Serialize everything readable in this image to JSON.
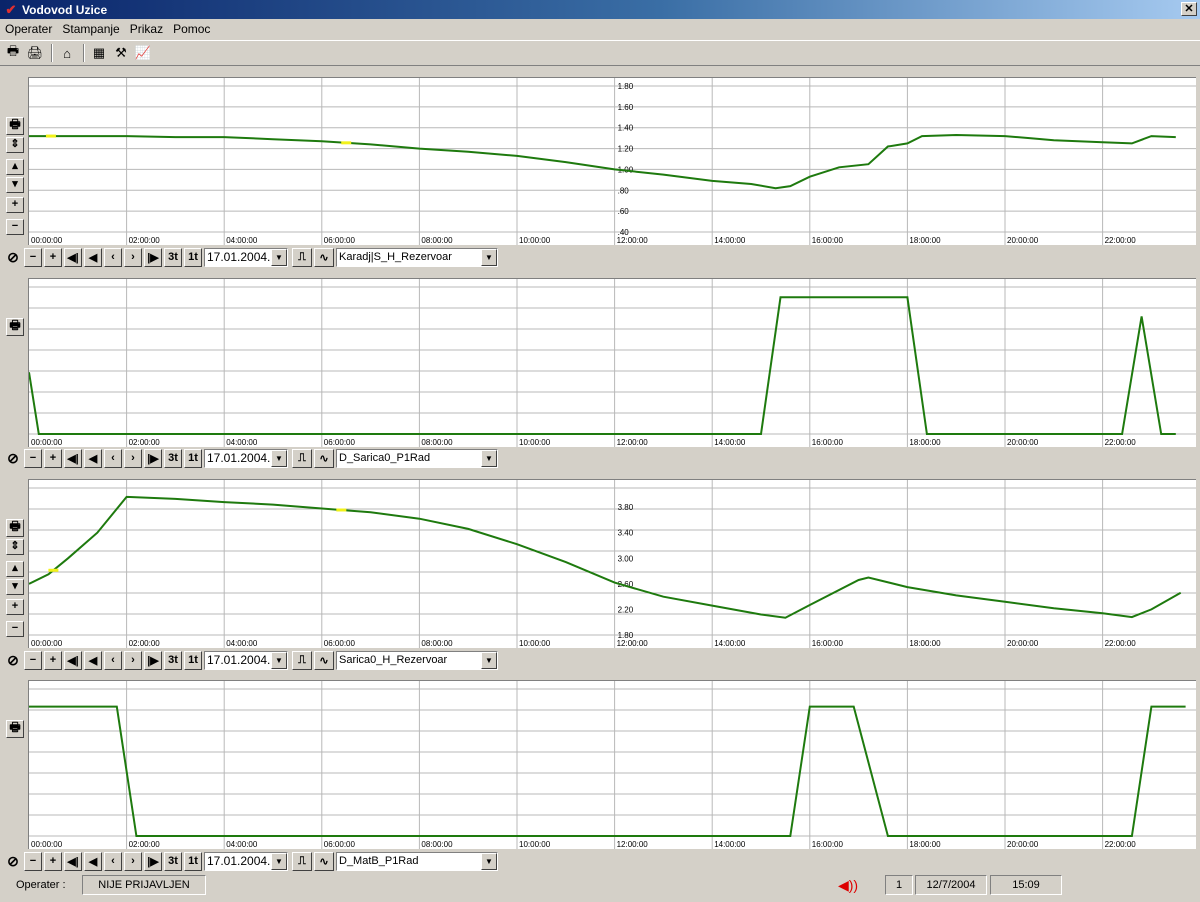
{
  "window": {
    "title": "Vodovod Uzice",
    "close_label": "✕"
  },
  "menu": [
    "Operater",
    "Stampanje",
    "Prikaz",
    "Pomoc"
  ],
  "toolbar": [
    {
      "name": "print-icon",
      "glyph": "🖶"
    },
    {
      "name": "print-color-icon",
      "glyph": "🖨"
    },
    {
      "name": "home-icon",
      "glyph": "⌂"
    },
    {
      "name": "network-icon",
      "glyph": "▦"
    },
    {
      "name": "tools-icon",
      "glyph": "⚒"
    },
    {
      "name": "trend-icon",
      "glyph": "📈"
    }
  ],
  "time_labels": [
    "00:00:00",
    "02:00:00",
    "04:00:00",
    "06:00:00",
    "08:00:00",
    "10:00:00",
    "12:00:00",
    "14:00:00",
    "16:00:00",
    "18:00:00",
    "20:00:00",
    "22:00:00"
  ],
  "colors": {
    "line": "#1e7a0e",
    "highlight": "#f2f21a",
    "grid": "#b8b8b8"
  },
  "chart_data": [
    {
      "type": "line",
      "series": [
        {
          "values": [
            [
              0,
              1.32
            ],
            [
              1,
              1.32
            ],
            [
              2,
              1.32
            ],
            [
              3,
              1.31
            ],
            [
              4,
              1.31
            ],
            [
              5,
              1.29
            ],
            [
              6,
              1.27
            ],
            [
              7,
              1.24
            ],
            [
              8,
              1.2
            ],
            [
              9,
              1.17
            ],
            [
              10,
              1.13
            ],
            [
              11,
              1.07
            ],
            [
              12,
              1.0
            ],
            [
              13,
              0.95
            ],
            [
              14,
              0.89
            ],
            [
              14.8,
              0.86
            ],
            [
              15.3,
              0.82
            ],
            [
              15.6,
              0.84
            ],
            [
              16,
              0.93
            ],
            [
              16.6,
              1.02
            ],
            [
              17.2,
              1.05
            ],
            [
              17.6,
              1.22
            ],
            [
              18,
              1.25
            ],
            [
              18.3,
              1.32
            ],
            [
              19,
              1.33
            ],
            [
              20,
              1.32
            ],
            [
              20.5,
              1.3
            ],
            [
              21,
              1.28
            ],
            [
              22,
              1.26
            ],
            [
              22.6,
              1.25
            ],
            [
              23,
              1.32
            ],
            [
              23.5,
              1.31
            ]
          ]
        }
      ],
      "yticks": [
        0.4,
        0.6,
        0.8,
        1.0,
        1.2,
        1.4,
        1.6,
        1.8
      ],
      "ytick_labels": [
        ".40",
        ".60",
        ".80",
        "1.00",
        "1.20",
        "1.40",
        "1.60",
        "1.80"
      ],
      "ylim": [
        0.4,
        1.8
      ],
      "xlim": [
        0,
        23.7
      ],
      "highlights": [
        0.45,
        6.5
      ],
      "tag": "Karadj|S_H_Rezervoar",
      "date": "17.01.2004.",
      "has_scale_controls": true
    },
    {
      "type": "line",
      "series": [
        {
          "values": [
            [
              0,
              0.42
            ],
            [
              0.2,
              0
            ],
            [
              15,
              0
            ],
            [
              15.4,
              0.93
            ],
            [
              18,
              0.93
            ],
            [
              18.4,
              0
            ],
            [
              22.4,
              0
            ],
            [
              22.8,
              0.8
            ],
            [
              23.2,
              0
            ],
            [
              23.5,
              0
            ]
          ]
        }
      ],
      "yticks": [],
      "ytick_labels": [],
      "ylim": [
        0,
        1
      ],
      "xlim": [
        0,
        23.7
      ],
      "highlights": [],
      "tag": "D_Sarica0_P1Rad",
      "date": "17.01.2004.",
      "has_scale_controls": false
    },
    {
      "type": "line",
      "series": [
        {
          "values": [
            [
              0,
              2.6
            ],
            [
              0.4,
              2.75
            ],
            [
              0.8,
              3.0
            ],
            [
              1.4,
              3.4
            ],
            [
              2,
              3.96
            ],
            [
              3,
              3.93
            ],
            [
              4,
              3.88
            ],
            [
              5,
              3.84
            ],
            [
              6,
              3.78
            ],
            [
              7,
              3.72
            ],
            [
              8,
              3.62
            ],
            [
              9,
              3.46
            ],
            [
              10,
              3.22
            ],
            [
              11,
              2.94
            ],
            [
              12,
              2.62
            ],
            [
              13,
              2.4
            ],
            [
              14,
              2.26
            ],
            [
              15,
              2.12
            ],
            [
              15.5,
              2.07
            ],
            [
              16,
              2.27
            ],
            [
              17,
              2.66
            ],
            [
              17.2,
              2.7
            ],
            [
              18,
              2.55
            ],
            [
              19,
              2.42
            ],
            [
              20,
              2.32
            ],
            [
              21,
              2.22
            ],
            [
              22,
              2.14
            ],
            [
              22.6,
              2.08
            ],
            [
              23,
              2.2
            ],
            [
              23.6,
              2.46
            ]
          ]
        }
      ],
      "yticks": [
        1.8,
        2.2,
        2.6,
        3.0,
        3.4,
        3.8
      ],
      "ytick_labels": [
        "1.80",
        "2.20",
        "2.60",
        "3.00",
        "3.40",
        "3.80"
      ],
      "ylim": [
        1.8,
        4.1
      ],
      "xlim": [
        0,
        23.7
      ],
      "highlights": [
        0.5,
        6.4
      ],
      "tag": "Sarica0_H_Rezervoar",
      "date": "17.01.2004.",
      "has_scale_controls": true
    },
    {
      "type": "line",
      "series": [
        {
          "values": [
            [
              0,
              0.88
            ],
            [
              1.8,
              0.88
            ],
            [
              2.2,
              0
            ],
            [
              15.6,
              0
            ],
            [
              16,
              0.88
            ],
            [
              16.9,
              0.88
            ],
            [
              17.6,
              0
            ],
            [
              22.6,
              0
            ],
            [
              23,
              0.88
            ],
            [
              23.7,
              0.88
            ]
          ]
        }
      ],
      "yticks": [],
      "ytick_labels": [],
      "ylim": [
        0,
        1
      ],
      "xlim": [
        0,
        23.7
      ],
      "highlights": [],
      "tag": "D_MatB_P1Rad",
      "date": "17.01.2004.",
      "has_scale_controls": false
    }
  ],
  "panel_controls": {
    "buttons": [
      {
        "name": "reset-button",
        "label": "⊘"
      },
      {
        "name": "zoom-out-button",
        "label": "−"
      },
      {
        "name": "zoom-in-button",
        "label": "+"
      },
      {
        "name": "first-button",
        "label": "◀|"
      },
      {
        "name": "prev-fast-button",
        "label": "◀"
      },
      {
        "name": "prev-button",
        "label": "‹"
      },
      {
        "name": "next-button",
        "label": "›"
      },
      {
        "name": "last-button",
        "label": "|▶"
      },
      {
        "name": "period-3t-button",
        "label": "3t"
      },
      {
        "name": "period-1t-button",
        "label": "1t"
      }
    ],
    "mode_buttons": [
      {
        "name": "step-mode-button",
        "label": "⎍"
      },
      {
        "name": "curve-mode-button",
        "label": "∿"
      }
    ],
    "side_buttons": [
      {
        "name": "print-panel-button",
        "label": "🖶"
      },
      {
        "name": "scale-toggle-button",
        "label": "⇕"
      },
      {
        "name": "scroll-up-button",
        "label": "▴"
      },
      {
        "name": "scroll-down-button",
        "label": "▾"
      },
      {
        "name": "scale-plus-button",
        "label": "+"
      },
      {
        "name": "scale-minus-button",
        "label": "−"
      }
    ]
  },
  "status": {
    "operator_label": "Operater :",
    "operator_value": "NIJE PRIJAVLJEN",
    "alarm_count": "1",
    "date": "12/7/2004",
    "time": "15:09",
    "speaker_glyph": "◀))"
  }
}
